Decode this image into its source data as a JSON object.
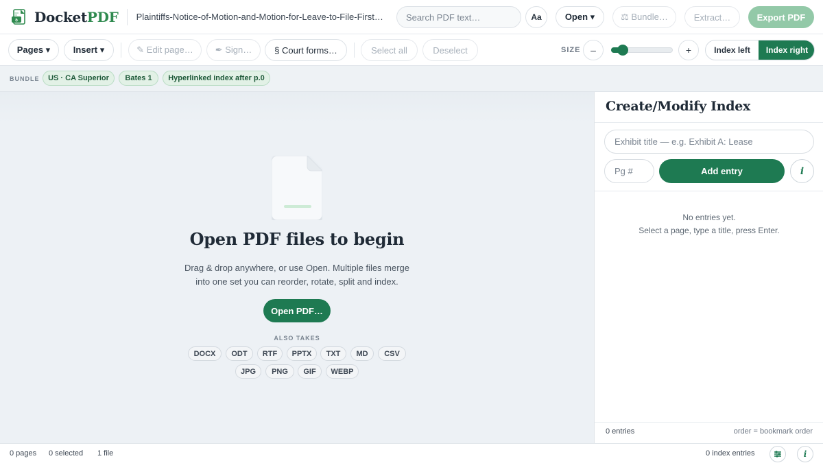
{
  "header": {
    "logo_text_dark": "Docket",
    "logo_text_accent": "PDF",
    "filename": "Plaintiffs-Notice-of-Motion-and-Motion-for-Leave-to-File-First-Amended-Complaint.pdf",
    "search_placeholder": "Search PDF text…",
    "font_button": "Aa",
    "open_button": "Open ▾",
    "bundle_button": "⚖ Bundle…",
    "extract_button": "Extract…",
    "export_button": "Export PDF"
  },
  "toolbar": {
    "pages_menu": "Pages ▾",
    "insert_menu": "Insert ▾",
    "edit_page": "✎ Edit page…",
    "sign": "✒ Sign…",
    "court_forms": "§ Court forms…",
    "select_all": "Select all",
    "deselect": "Deselect",
    "size_label": "SIZE",
    "size_minus": "–",
    "size_plus": "+",
    "size_level": 0.12,
    "index_left": "Index left",
    "index_right": "Index right"
  },
  "bundle": {
    "label": "BUNDLE",
    "chips": [
      "US · CA Superior",
      "Bates 1",
      "Hyperlinked index after p.0"
    ]
  },
  "main": {
    "title": "Open PDF files to begin",
    "subtitle_line1": "Drag & drop anywhere, or use Open. Multiple files merge",
    "subtitle_line2": "into one set you can reorder, rotate, split and index.",
    "open_button": "Open PDF…",
    "also_takes_label": "ALSO TAKES",
    "formats_row1": [
      "DOCX",
      "ODT",
      "RTF",
      "PPTX",
      "TXT",
      "MD",
      "CSV"
    ],
    "formats_row2": [
      "JPG",
      "PNG",
      "GIF",
      "WEBP"
    ]
  },
  "index_panel": {
    "title": "Create/Modify Index",
    "title_placeholder": "Exhibit title — e.g. Exhibit A: Lease",
    "page_placeholder": "Pg #",
    "add_button": "Add entry",
    "info_button": "i",
    "empty_line1": "No entries yet.",
    "empty_line2": "Select a page, type a title, press Enter.",
    "entries_count": "0 entries",
    "order_note": "order = bookmark order"
  },
  "status": {
    "pages": "0 pages",
    "selected": "0 selected",
    "files": "1 file",
    "index_entries": "0 index entries",
    "info_button": "i"
  },
  "colors": {
    "brand_green": "#1e7a52",
    "logo_accent": "#2f8a4f",
    "chip_bg": "#e2f1e6",
    "export_disabled": "#93c9a8"
  }
}
